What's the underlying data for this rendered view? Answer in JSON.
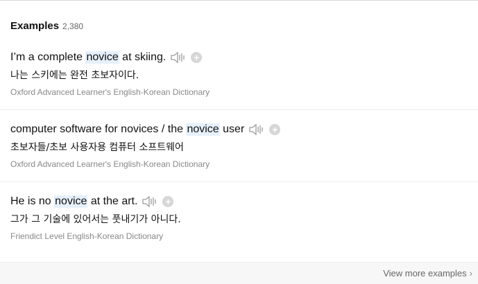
{
  "section": {
    "title": "Examples",
    "count": "2,380"
  },
  "examples": [
    {
      "pre": "I’m a complete ",
      "highlight": "novice",
      "post": " at skiing.",
      "translation": "나는 스키에는 완전 초보자이다.",
      "source": "Oxford Advanced Learner's English-Korean Dictionary"
    },
    {
      "pre": "computer software for novices / the ",
      "highlight": "novice",
      "post": " user",
      "translation": "초보자들/초보 사용자용 컴퓨터 소프트웨어",
      "source": "Oxford Advanced Learner's English-Korean Dictionary"
    },
    {
      "pre": "He is no ",
      "highlight": "novice",
      "post": " at the art.",
      "translation": "그가 그 기술에 있어서는 풋내기가 아니다.",
      "source": "Friendict Level English-Korean Dictionary"
    }
  ],
  "footer": {
    "view_more": "View more examples"
  },
  "icons": {
    "audio": "speaker-icon",
    "add": "plus-icon",
    "more": "chevron-right-icon"
  }
}
